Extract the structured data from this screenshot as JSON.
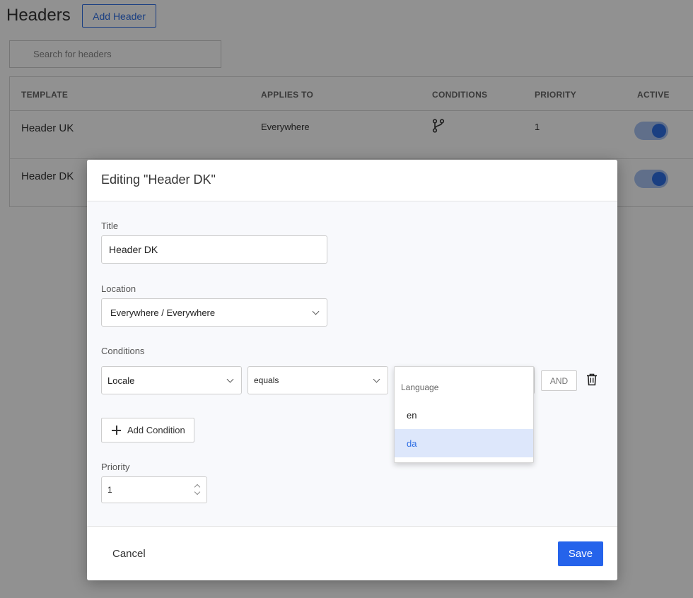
{
  "page": {
    "title": "Headers",
    "add_header_label": "Add Header",
    "search_placeholder": "Search for headers"
  },
  "table": {
    "columns": [
      "TEMPLATE",
      "APPLIES TO",
      "CONDITIONS",
      "PRIORITY",
      "ACTIVE"
    ],
    "rows": [
      {
        "template": "Header UK",
        "applies_to": "Everywhere",
        "has_conditions": true,
        "priority": "1",
        "active": true
      },
      {
        "template": "Header DK",
        "active": true
      }
    ]
  },
  "modal": {
    "title": "Editing \"Header DK\"",
    "title_label": "Title",
    "title_value": "Header DK",
    "location_label": "Location",
    "location_value": "Everywhere / Everywhere",
    "conditions_label": "Conditions",
    "condition": {
      "field": "Locale",
      "operator": "equals",
      "join": "AND"
    },
    "add_condition_label": "Add Condition",
    "priority_label": "Priority",
    "priority_value": "1",
    "cancel_label": "Cancel",
    "save_label": "Save"
  },
  "dropdown": {
    "group_label": "Language",
    "options": [
      "en",
      "da"
    ],
    "highlighted": "da"
  },
  "colors": {
    "accent": "#2563eb",
    "toggle_track": "#a9c4f3",
    "highlight_bg": "#dde7fb"
  }
}
